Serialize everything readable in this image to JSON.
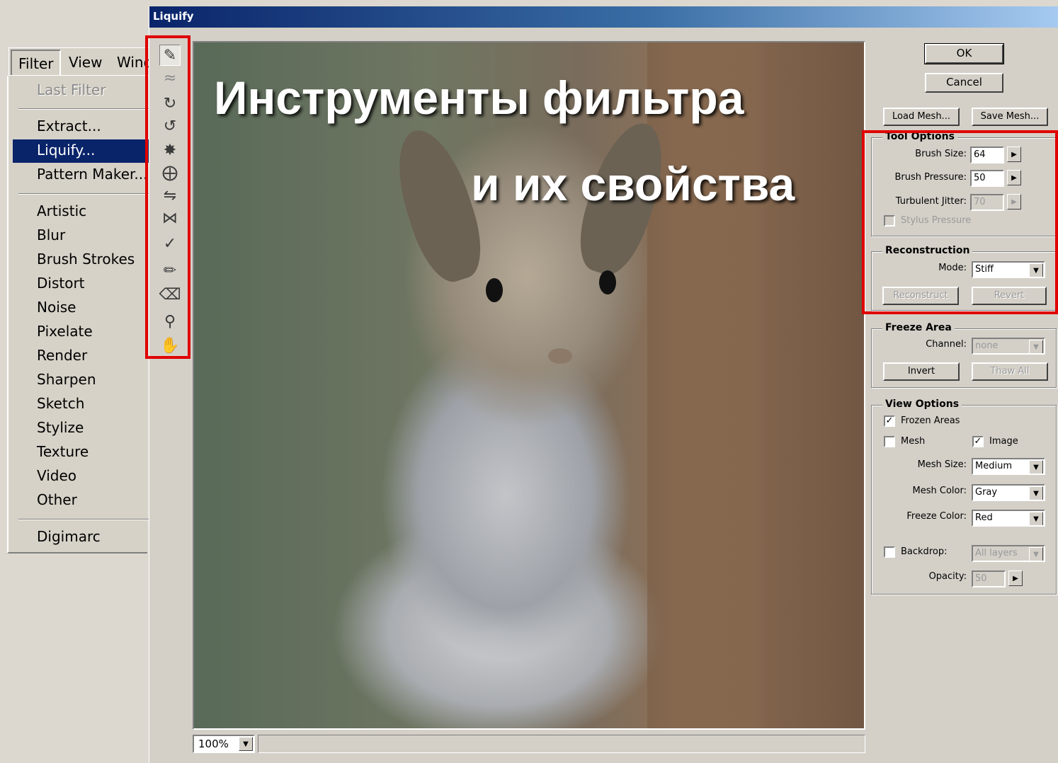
{
  "menu": {
    "bar_items": [
      "Filter",
      "View",
      "Wind"
    ],
    "items": [
      {
        "label": "Last Filter",
        "disabled": true
      },
      {
        "label": "Extract..."
      },
      {
        "label": "Liquify...",
        "selected": true
      },
      {
        "label": "Pattern Maker..."
      },
      {
        "label": "Artistic"
      },
      {
        "label": "Blur"
      },
      {
        "label": "Brush Strokes"
      },
      {
        "label": "Distort"
      },
      {
        "label": "Noise"
      },
      {
        "label": "Pixelate"
      },
      {
        "label": "Render"
      },
      {
        "label": "Sharpen"
      },
      {
        "label": "Sketch"
      },
      {
        "label": "Stylize"
      },
      {
        "label": "Texture"
      },
      {
        "label": "Video"
      },
      {
        "label": "Other"
      },
      {
        "label": "Digimarc"
      }
    ]
  },
  "window": {
    "title": "Liquify"
  },
  "tools": [
    "warp-icon",
    "turbulence-icon",
    "twirl-cw-icon",
    "twirl-ccw-icon",
    "pucker-icon",
    "bloat-icon",
    "shift-pixels-icon",
    "reflection-icon",
    "reconstruct-icon",
    "freeze-icon",
    "thaw-icon",
    "zoom-icon",
    "hand-icon"
  ],
  "overlay": {
    "line1": "Инструменты фильтра",
    "line2": "и их свойства"
  },
  "zoom": {
    "value": "100%"
  },
  "buttons": {
    "ok": "OK",
    "cancel": "Cancel",
    "load_mesh": "Load Mesh...",
    "save_mesh": "Save Mesh..."
  },
  "tool_options": {
    "title": "Tool Options",
    "brush_size_label": "Brush Size:",
    "brush_size": "64",
    "brush_pressure_label": "Brush Pressure:",
    "brush_pressure": "50",
    "turbulent_jitter_label": "Turbulent Jitter:",
    "turbulent_jitter": "70",
    "stylus_pressure": "Stylus Pressure"
  },
  "reconstruction": {
    "title": "Reconstruction",
    "mode_label": "Mode:",
    "mode": "Stiff",
    "reconstruct": "Reconstruct",
    "revert": "Revert"
  },
  "freeze_area": {
    "title": "Freeze Area",
    "channel_label": "Channel:",
    "channel": "none",
    "invert": "Invert",
    "thaw_all": "Thaw All"
  },
  "view_options": {
    "title": "View Options",
    "frozen_areas": "Frozen Areas",
    "frozen_areas_checked": true,
    "mesh": "Mesh",
    "mesh_checked": false,
    "image": "Image",
    "image_checked": true,
    "mesh_size_label": "Mesh Size:",
    "mesh_size": "Medium",
    "mesh_color_label": "Mesh Color:",
    "mesh_color": "Gray",
    "freeze_color_label": "Freeze Color:",
    "freeze_color": "Red",
    "backdrop": "Backdrop:",
    "backdrop_checked": false,
    "backdrop_value": "All layers",
    "opacity_label": "Opacity:",
    "opacity": "50"
  },
  "colors": {
    "highlight": "#e00000",
    "selection": "#0a246a"
  }
}
